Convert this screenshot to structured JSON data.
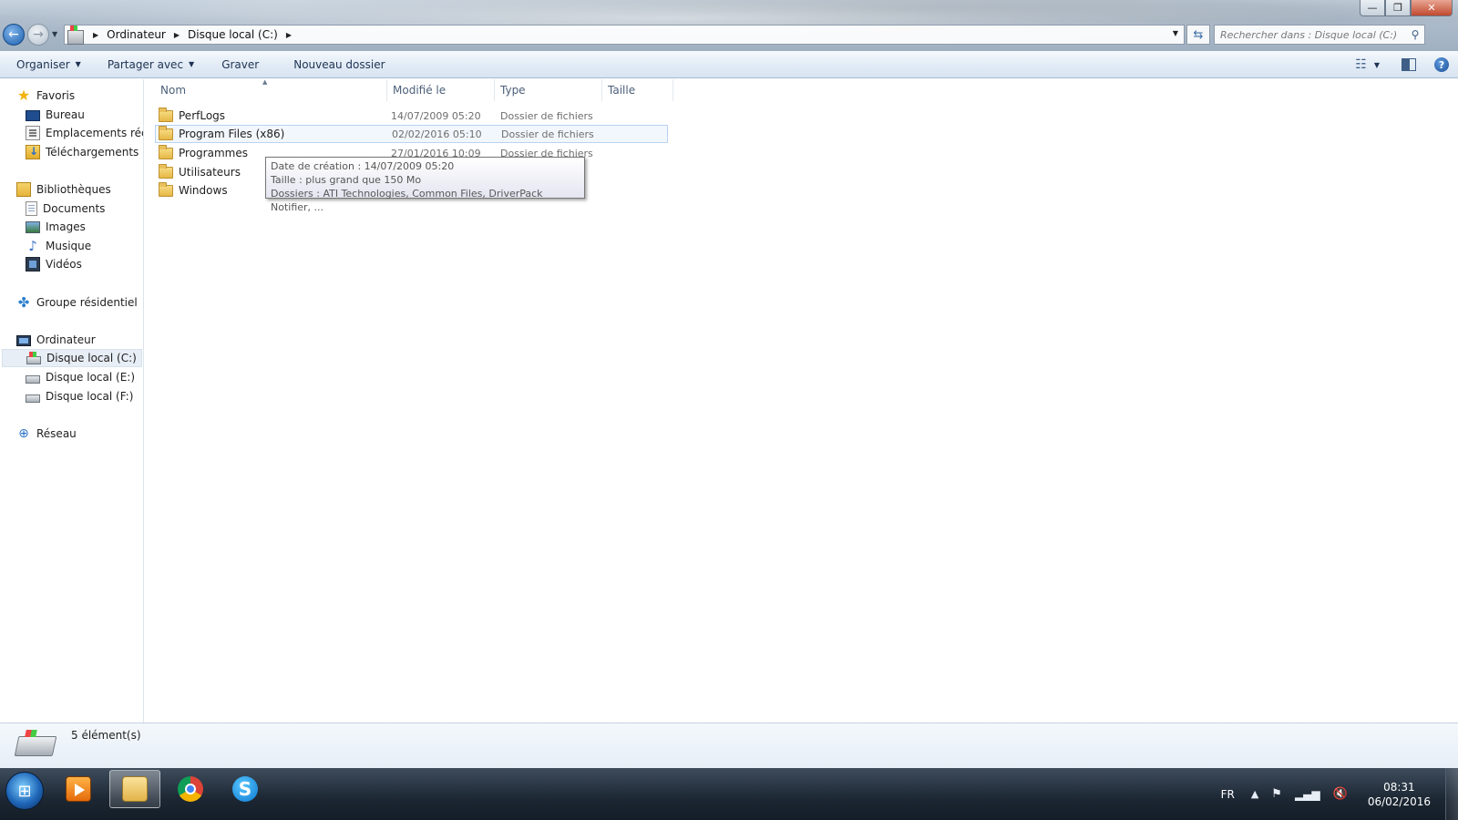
{
  "window": {
    "minimize_glyph": "—",
    "maximize_glyph": "❐",
    "close_glyph": "✕"
  },
  "address": {
    "crumbs": [
      "Ordinateur",
      "Disque local (C:)"
    ],
    "search_placeholder": "Rechercher dans : Disque local (C:)"
  },
  "toolbar": {
    "organize": "Organiser",
    "share": "Partager avec",
    "burn": "Graver",
    "new_folder": "Nouveau dossier"
  },
  "nav": {
    "favorites": "Favoris",
    "desktop": "Bureau",
    "recent": "Emplacements récents",
    "downloads": "Téléchargements",
    "libraries": "Bibliothèques",
    "documents": "Documents",
    "images": "Images",
    "music": "Musique",
    "videos": "Vidéos",
    "homegroup": "Groupe résidentiel",
    "computer": "Ordinateur",
    "drive_c": "Disque local (C:)",
    "drive_e": "Disque local (E:)",
    "drive_f": "Disque local (F:)",
    "network": "Réseau"
  },
  "columns": {
    "name": "Nom",
    "modified": "Modifié le",
    "type": "Type",
    "size": "Taille"
  },
  "files": [
    {
      "name": "PerfLogs",
      "modified": "14/07/2009 05:20",
      "type": "Dossier de fichiers"
    },
    {
      "name": "Program Files (x86)",
      "modified": "02/02/2016 05:10",
      "type": "Dossier de fichiers"
    },
    {
      "name": "Programmes",
      "modified": "27/01/2016 10:09",
      "type": "Dossier de fichiers"
    },
    {
      "name": "Utilisateurs",
      "modified": "",
      "type": ""
    },
    {
      "name": "Windows",
      "modified": "",
      "type": ""
    }
  ],
  "tooltip": {
    "line1": "Date de création : 14/07/2009 05:20",
    "line2": "Taille : plus grand que 150 Mo",
    "line3": "Dossiers : ATI Technologies, Common Files, DriverPack Notifier, ..."
  },
  "details": {
    "count": "5 élément(s)"
  },
  "taskbar": {
    "lang": "FR",
    "time": "08:31",
    "date": "06/02/2016"
  },
  "colors": {
    "accent": "#1d5fae",
    "taskbar": "#1c2733",
    "hover_border": "#b8d3f1"
  }
}
